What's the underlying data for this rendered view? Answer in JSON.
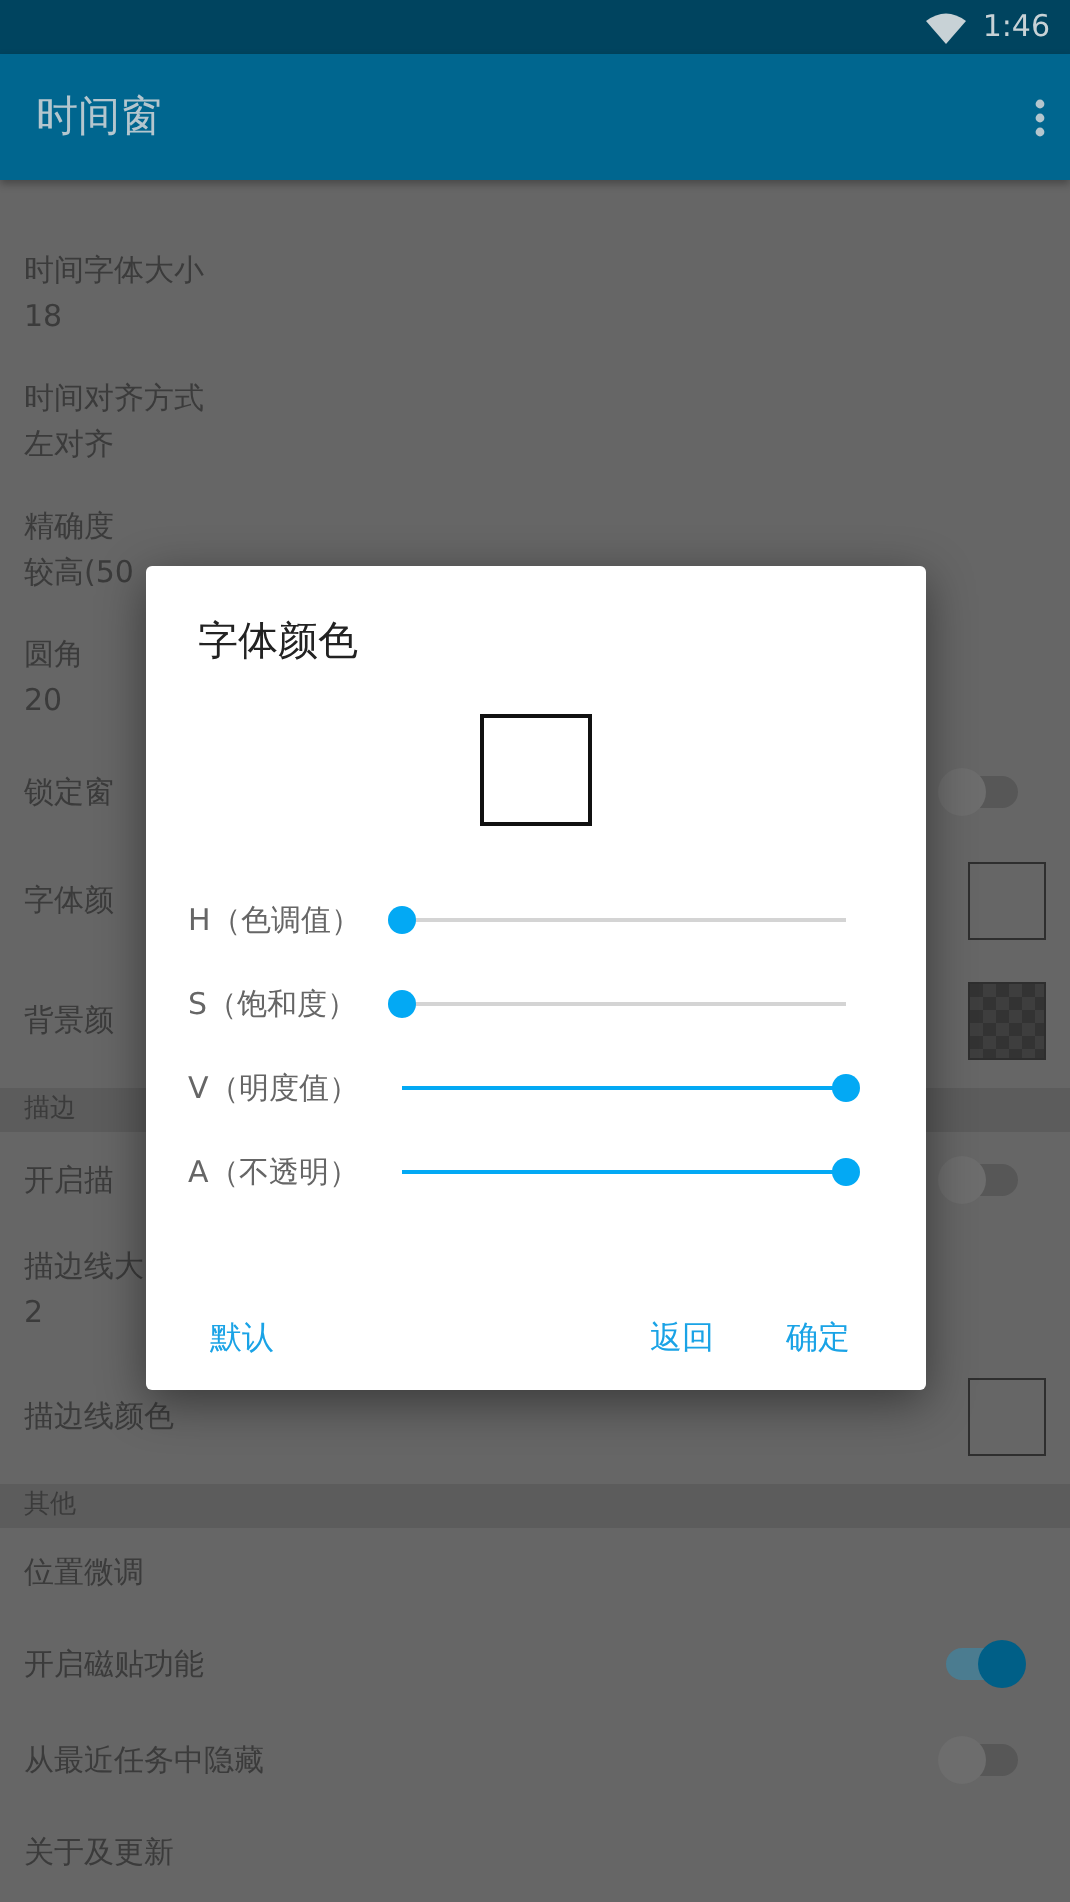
{
  "status_bar": {
    "time": "1:46"
  },
  "app_bar": {
    "title": "时间窗"
  },
  "settings": [
    {
      "kind": "text",
      "title": "时间字体大小",
      "value": "18"
    },
    {
      "kind": "text",
      "title": "时间对齐方式",
      "value": "左对齐"
    },
    {
      "kind": "text",
      "title": "精确度",
      "value": "较高(50"
    },
    {
      "kind": "text",
      "title": "圆角",
      "value": "20"
    },
    {
      "kind": "switch",
      "title": "锁定窗",
      "on": false
    },
    {
      "kind": "swatch",
      "title": "字体颜",
      "color": "#666666"
    },
    {
      "kind": "checker",
      "title": "背景颜"
    },
    {
      "kind": "header",
      "title": "描边"
    },
    {
      "kind": "switch",
      "title": "开启描",
      "on": false
    },
    {
      "kind": "text",
      "title": "描边线大",
      "value": "2"
    },
    {
      "kind": "swatch",
      "title": "描边线颜色",
      "color": "#666666"
    },
    {
      "kind": "header",
      "title": "其他"
    },
    {
      "kind": "plain",
      "title": "位置微调"
    },
    {
      "kind": "switch",
      "title": "开启磁贴功能",
      "on": true
    },
    {
      "kind": "switch",
      "title": "从最近任务中隐藏",
      "on": false
    },
    {
      "kind": "plain",
      "title": "关于及更新"
    }
  ],
  "dialog": {
    "title": "字体颜色",
    "sliders": [
      {
        "label": "H（色调值）",
        "level": 0
      },
      {
        "label": "S（饱和度）",
        "level": 0
      },
      {
        "label": "V（明度值）",
        "level": 1
      },
      {
        "label": "A（不透明）",
        "level": 1
      }
    ],
    "left_button": "默认",
    "right_buttons": [
      "返回",
      "确定"
    ]
  }
}
